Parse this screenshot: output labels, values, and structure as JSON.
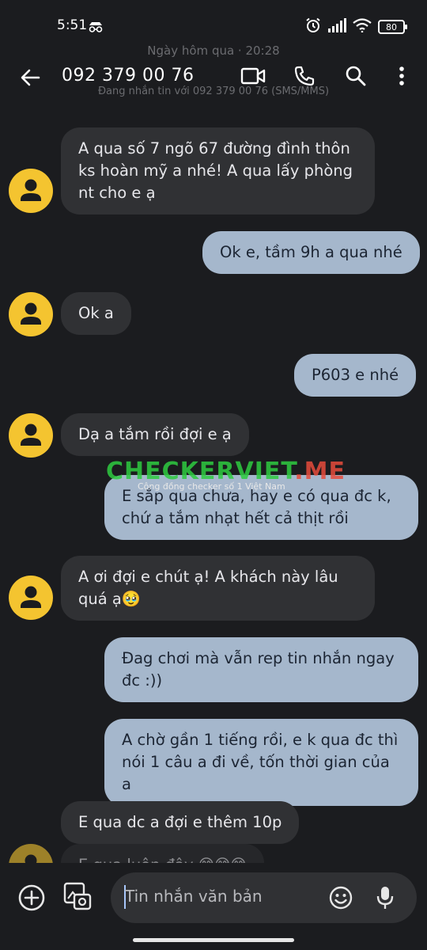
{
  "status_bar": {
    "time": "5:51",
    "battery": "80"
  },
  "conversation_meta": {
    "date_separator": "Ngày hôm qua · 20:28",
    "sim_info": "Đang nhắn tin với 092 379 00 76 (SMS/MMS)"
  },
  "app_bar": {
    "contact": "092 379 00 76"
  },
  "messages": [
    {
      "dir": "in",
      "text": "A qua số 7 ngõ 67 đường đình thôn ks hoàn mỹ a nhé! A qua lấy phòng nt cho e ạ"
    },
    {
      "dir": "out",
      "text": "Ok e, tầm 9h a qua nhé"
    },
    {
      "dir": "in",
      "text": "Ok a"
    },
    {
      "dir": "out",
      "text": "P603 e nhé"
    },
    {
      "dir": "in",
      "text": "Dạ a tắm rồi đợi e ạ"
    },
    {
      "dir": "out",
      "text": "E sắp qua chưa, hay e có qua đc k, chứ a tắm nhạt hết cả thịt rồi"
    },
    {
      "dir": "in",
      "text": "A ơi đợi e chút ạ! A khách này lâu quá ạ🥹"
    },
    {
      "dir": "out",
      "text": "Đag chơi mà vẫn rep tin nhắn ngay đc :))"
    },
    {
      "dir": "out",
      "text": "A chờ gần 1 tiếng rồi, e k qua đc thì nói 1 câu a đi về, tốn thời gian của a"
    },
    {
      "dir": "in",
      "text": "E qua dc a đợi e thêm 10p"
    },
    {
      "dir": "in",
      "text": "E qua luôn đây 😅😅😅"
    }
  ],
  "watermark": {
    "brand": "CHECKERVIET",
    "tld": ".ME",
    "tagline": "Cộng đồng checker số 1 Việt Nam"
  },
  "compose": {
    "placeholder": "Tin nhắn văn bản"
  },
  "icons": {
    "incognito": "incognito-icon",
    "alarm": "alarm-icon",
    "signal": "signal-icon",
    "wifi": "wifi-icon",
    "back": "back-arrow-icon",
    "video": "video-call-icon",
    "phone": "phone-icon",
    "search": "search-icon",
    "more": "more-vert-icon",
    "avatar": "person-icon",
    "add": "add-circle-icon",
    "gallery": "gallery-icon",
    "emoji": "emoji-icon",
    "mic": "mic-icon"
  },
  "colors": {
    "background": "#1b1c1f",
    "incoming_bubble": "#303134",
    "outgoing_bubble": "#a5b7cc",
    "avatar": "#f4c430"
  }
}
